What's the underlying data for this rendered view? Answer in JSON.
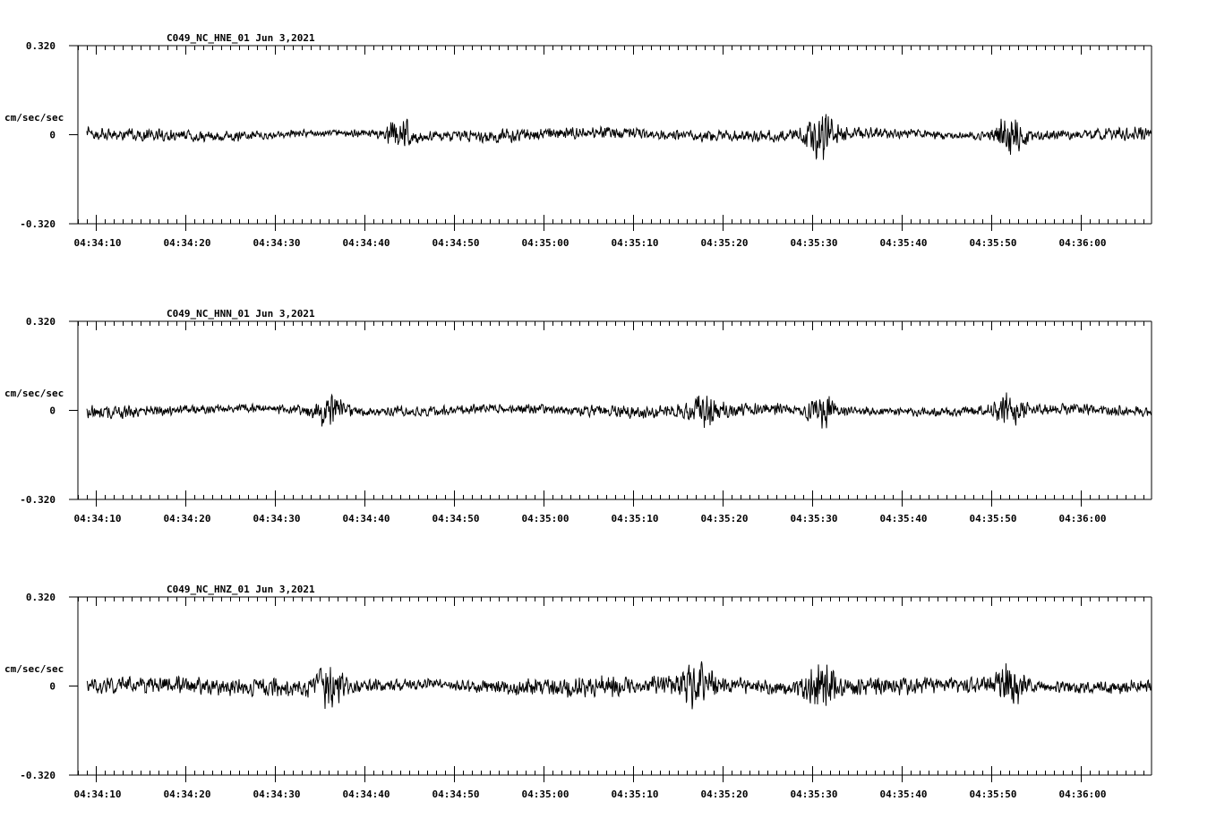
{
  "colors": {
    "background": "#ffffff",
    "trace": "#000000",
    "axis": "#000000"
  },
  "chart_data": [
    {
      "type": "line",
      "title": "C049_NC_HNE_01   Jun 3,2021",
      "ylabel": "cm/sec/sec",
      "ylim": [
        -0.32,
        0.32
      ],
      "y_tick_labels": [
        "0.320",
        "0",
        "-0.320"
      ],
      "x_tick_labels": [
        "04:34:10",
        "04:34:20",
        "04:34:30",
        "04:34:40",
        "04:34:50",
        "04:35:00",
        "04:35:10",
        "04:35:20",
        "04:35:30",
        "04:35:40",
        "04:35:50",
        "04:36:00"
      ],
      "x_range_seconds": [
        "04:34:08",
        "04:36:08"
      ],
      "series": [
        {
          "noise_amplitude": 0.03,
          "bursts": [
            {
              "time": "04:34:44",
              "amplitude": 0.05
            },
            {
              "time": "04:35:31",
              "amplitude": 0.09
            },
            {
              "time": "04:35:52",
              "amplitude": 0.07
            }
          ]
        }
      ]
    },
    {
      "type": "line",
      "title": "C049_NC_HNN_01   Jun 3,2021",
      "ylabel": "cm/sec/sec",
      "ylim": [
        -0.32,
        0.32
      ],
      "y_tick_labels": [
        "0.320",
        "0",
        "-0.320"
      ],
      "x_tick_labels": [
        "04:34:10",
        "04:34:20",
        "04:34:30",
        "04:34:40",
        "04:34:50",
        "04:35:00",
        "04:35:10",
        "04:35:20",
        "04:35:30",
        "04:35:40",
        "04:35:50",
        "04:36:00"
      ],
      "x_range_seconds": [
        "04:34:08",
        "04:36:08"
      ],
      "series": [
        {
          "noise_amplitude": 0.03,
          "bursts": [
            {
              "time": "04:34:36",
              "amplitude": 0.05
            },
            {
              "time": "04:35:18",
              "amplitude": 0.05
            },
            {
              "time": "04:35:31",
              "amplitude": 0.06
            },
            {
              "time": "04:35:52",
              "amplitude": 0.05
            }
          ]
        }
      ]
    },
    {
      "type": "line",
      "title": "C049_NC_HNZ_01   Jun 3,2021",
      "ylabel": "cm/sec/sec",
      "ylim": [
        -0.32,
        0.32
      ],
      "y_tick_labels": [
        "0.320",
        "0",
        "-0.320"
      ],
      "x_tick_labels": [
        "04:34:10",
        "04:34:20",
        "04:34:30",
        "04:34:40",
        "04:34:50",
        "04:35:00",
        "04:35:10",
        "04:35:20",
        "04:35:30",
        "04:35:40",
        "04:35:50",
        "04:36:00"
      ],
      "x_range_seconds": [
        "04:34:08",
        "04:36:08"
      ],
      "series": [
        {
          "noise_amplitude": 0.045,
          "bursts": [
            {
              "time": "04:34:36",
              "amplitude": 0.08
            },
            {
              "time": "04:35:17",
              "amplitude": 0.07
            },
            {
              "time": "04:35:31",
              "amplitude": 0.08
            },
            {
              "time": "04:35:52",
              "amplitude": 0.07
            }
          ]
        }
      ]
    }
  ]
}
